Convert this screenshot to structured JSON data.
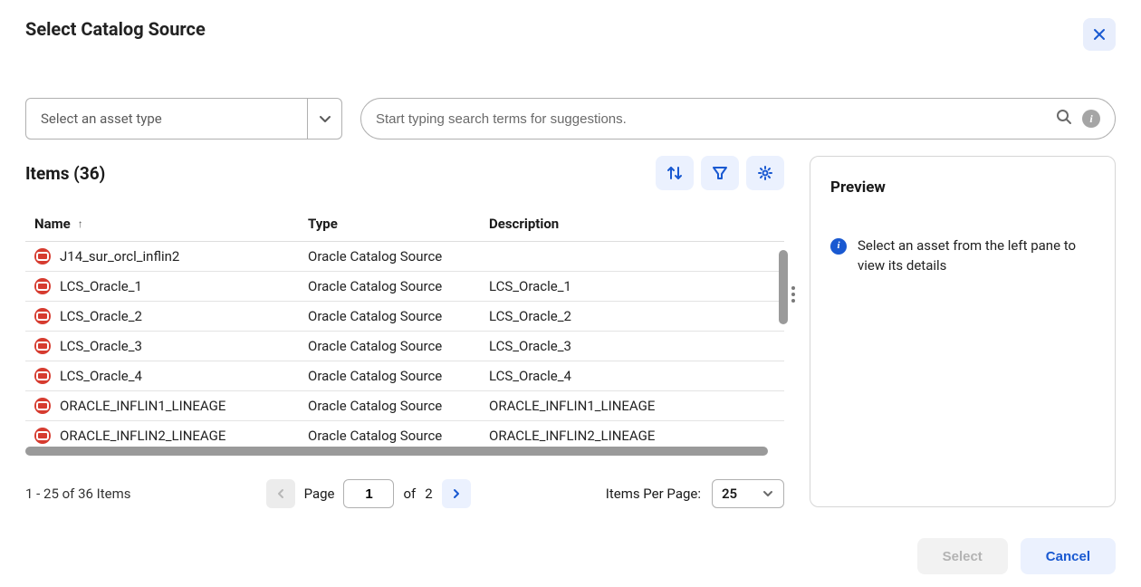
{
  "title": "Select Catalog Source",
  "assetTypeSelect": {
    "placeholder": "Select an asset type"
  },
  "search": {
    "placeholder": "Start typing search terms for suggestions."
  },
  "items": {
    "heading_prefix": "Items",
    "count": 36,
    "heading": "Items (36)",
    "columns": {
      "name": "Name",
      "type": "Type",
      "description": "Description"
    },
    "sort": {
      "column": "name",
      "direction": "asc"
    },
    "rows": [
      {
        "name": "J14_sur_orcl_inflin2",
        "type": "Oracle Catalog Source",
        "description": ""
      },
      {
        "name": "LCS_Oracle_1",
        "type": "Oracle Catalog Source",
        "description": "LCS_Oracle_1"
      },
      {
        "name": "LCS_Oracle_2",
        "type": "Oracle Catalog Source",
        "description": "LCS_Oracle_2"
      },
      {
        "name": "LCS_Oracle_3",
        "type": "Oracle Catalog Source",
        "description": "LCS_Oracle_3"
      },
      {
        "name": "LCS_Oracle_4",
        "type": "Oracle Catalog Source",
        "description": "LCS_Oracle_4"
      },
      {
        "name": "ORACLE_INFLIN1_LINEAGE",
        "type": "Oracle Catalog Source",
        "description": "ORACLE_INFLIN1_LINEAGE"
      },
      {
        "name": "ORACLE_INFLIN2_LINEAGE",
        "type": "Oracle Catalog Source",
        "description": "ORACLE_INFLIN2_LINEAGE"
      }
    ]
  },
  "pagination": {
    "summary": "1 - 25 of 36 Items",
    "page_label": "Page",
    "current_page": "1",
    "of_label": "of",
    "total_pages": "2",
    "items_per_page_label": "Items Per Page:",
    "items_per_page": "25"
  },
  "preview": {
    "title": "Preview",
    "empty_message": "Select an asset from the left pane to view its details"
  },
  "footer": {
    "select_label": "Select",
    "cancel_label": "Cancel"
  }
}
